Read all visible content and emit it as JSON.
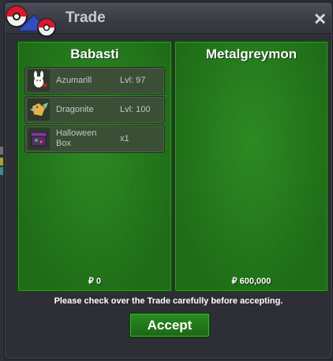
{
  "window": {
    "title": "Trade",
    "close_label": "✕"
  },
  "left_trader": {
    "name": "Babasti",
    "money": "₽ 0",
    "items": [
      {
        "name": "Azumarill",
        "detail": "Lvl: 97",
        "icon": "azumarill-icon"
      },
      {
        "name": "Dragonite",
        "detail": "Lvl: 100",
        "icon": "dragonite-icon"
      },
      {
        "name": "Halloween Box",
        "name_line1": "Halloween",
        "name_line2": "Box",
        "detail": "x1",
        "icon": "halloween-box-icon"
      }
    ]
  },
  "right_trader": {
    "name": "Metalgreymon",
    "money": "₽ 600,000",
    "items": []
  },
  "notice": "Please check over the Trade carefully before accepting.",
  "accept_label": "Accept",
  "colors": {
    "panel_green": "#277a1f",
    "window_bg": "#2e2e36",
    "accent_red": "#d8192b",
    "accent_blue": "#2f4fc0"
  }
}
